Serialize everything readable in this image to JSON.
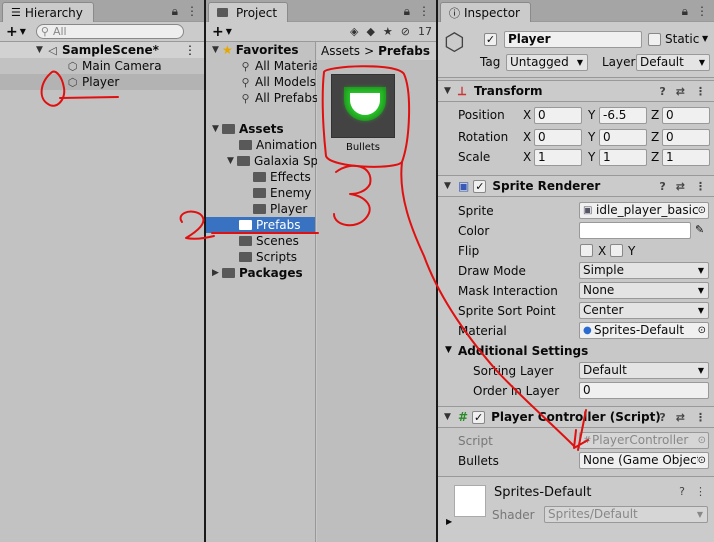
{
  "hierarchy": {
    "tab": "Hierarchy",
    "search_placeholder": "All",
    "scene": "SampleScene*",
    "items": [
      "Main Camera",
      "Player"
    ]
  },
  "project": {
    "tab": "Project",
    "visible_count": "17",
    "favorites": {
      "label": "Favorites",
      "items": [
        "All Materia",
        "All Models",
        "All Prefabs"
      ]
    },
    "assets": {
      "label": "Assets",
      "items": [
        "Animation",
        "Galaxia Sp",
        "Effects",
        "Enemy",
        "Player",
        "Prefabs",
        "Scenes",
        "Scripts"
      ]
    },
    "packages": "Packages",
    "breadcrumb": {
      "root": "Assets",
      "sep": ">",
      "current": "Prefabs"
    },
    "asset_tile": "Bullets"
  },
  "inspector": {
    "tab": "Inspector",
    "object_name": "Player",
    "static_label": "Static",
    "tag_label": "Tag",
    "tag_value": "Untagged",
    "layer_label": "Layer",
    "layer_value": "Default",
    "transform": {
      "title": "Transform",
      "rows": [
        {
          "label": "Position",
          "x": "0",
          "y": "-6.5",
          "z": "0"
        },
        {
          "label": "Rotation",
          "x": "0",
          "y": "0",
          "z": "0"
        },
        {
          "label": "Scale",
          "x": "1",
          "y": "1",
          "z": "1"
        }
      ],
      "axis": {
        "x": "X",
        "y": "Y",
        "z": "Z"
      }
    },
    "sprite_renderer": {
      "title": "Sprite Renderer",
      "sprite_label": "Sprite",
      "sprite_value": "idle_player_basic",
      "color_label": "Color",
      "flip_label": "Flip",
      "flip_x": "X",
      "flip_y": "Y",
      "draw_mode_label": "Draw Mode",
      "draw_mode_value": "Simple",
      "mask_label": "Mask Interaction",
      "mask_value": "None",
      "sort_point_label": "Sprite Sort Point",
      "sort_point_value": "Center",
      "material_label": "Material",
      "material_value": "Sprites-Default",
      "additional": "Additional Settings",
      "sorting_layer_label": "Sorting Layer",
      "sorting_layer_value": "Default",
      "order_label": "Order in Layer",
      "order_value": "0"
    },
    "player_controller": {
      "title": "Player Controller (Script)",
      "script_label": "Script",
      "script_value": "PlayerController",
      "bullets_label": "Bullets",
      "bullets_value": "None (Game Object)"
    },
    "material": {
      "title": "Sprites-Default",
      "shader_label": "Shader",
      "shader_value": "Sprites/Default"
    }
  },
  "annotations": [
    "1",
    "2",
    "3"
  ]
}
